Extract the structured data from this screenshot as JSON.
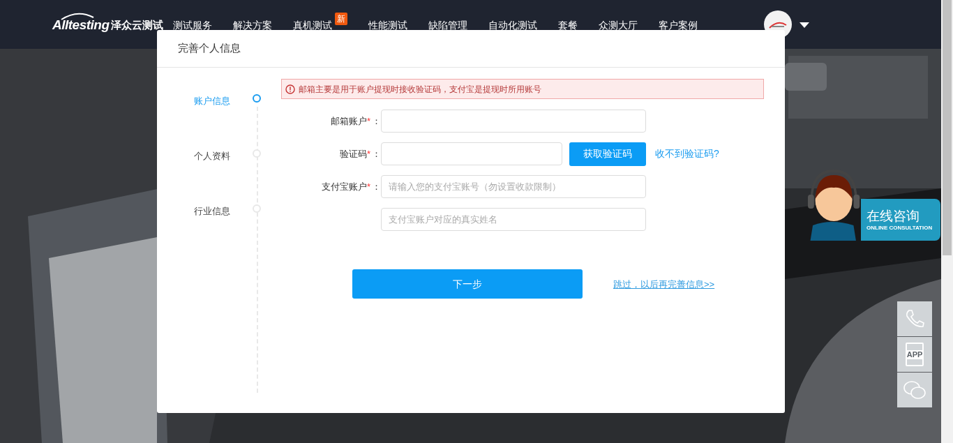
{
  "header": {
    "logo": {
      "brand": "Alltesting",
      "name": "泽众云测试"
    },
    "nav": [
      {
        "label": "测试服务"
      },
      {
        "label": "解决方案"
      },
      {
        "label": "真机测试",
        "badge": "新"
      },
      {
        "label": "性能测试"
      },
      {
        "label": "缺陷管理"
      },
      {
        "label": "自动化测试"
      },
      {
        "label": "套餐"
      },
      {
        "label": "众测大厅"
      },
      {
        "label": "客户案例"
      }
    ]
  },
  "dialog": {
    "title": "完善个人信息",
    "steps": [
      {
        "label": "账户信息",
        "selected": true
      },
      {
        "label": "个人资料",
        "selected": false
      },
      {
        "label": "行业信息",
        "selected": false
      }
    ],
    "alert": "邮箱主要是用于账户提现时接收验证码，支付宝是提现时所用账号",
    "fields": [
      {
        "kind": "plain",
        "label": "邮箱账户",
        "required_mark": "*",
        "colon": "："
      },
      {
        "kind": "code",
        "label": "验证码",
        "required_mark": "*",
        "colon": "：",
        "button": "获取验证码",
        "link": "收不到验证码?"
      },
      {
        "kind": "plain",
        "label": "支付宝账户",
        "required_mark": "*",
        "colon": "：",
        "placeholder": "请输入您的支付宝账号（勿设置收款限制）"
      },
      {
        "kind": "plain",
        "placeholder": "支付宝账户对应的真实姓名"
      }
    ],
    "next_button": "下一步",
    "skip_link": "跳过，以后再完善信息>>"
  },
  "consult": {
    "title": "在线咨询",
    "subtitle": "ONLINE CONSULTATION"
  },
  "side_tools": [
    {
      "kind": "phone"
    },
    {
      "kind": "app",
      "label": "APP"
    },
    {
      "kind": "chat"
    }
  ]
}
